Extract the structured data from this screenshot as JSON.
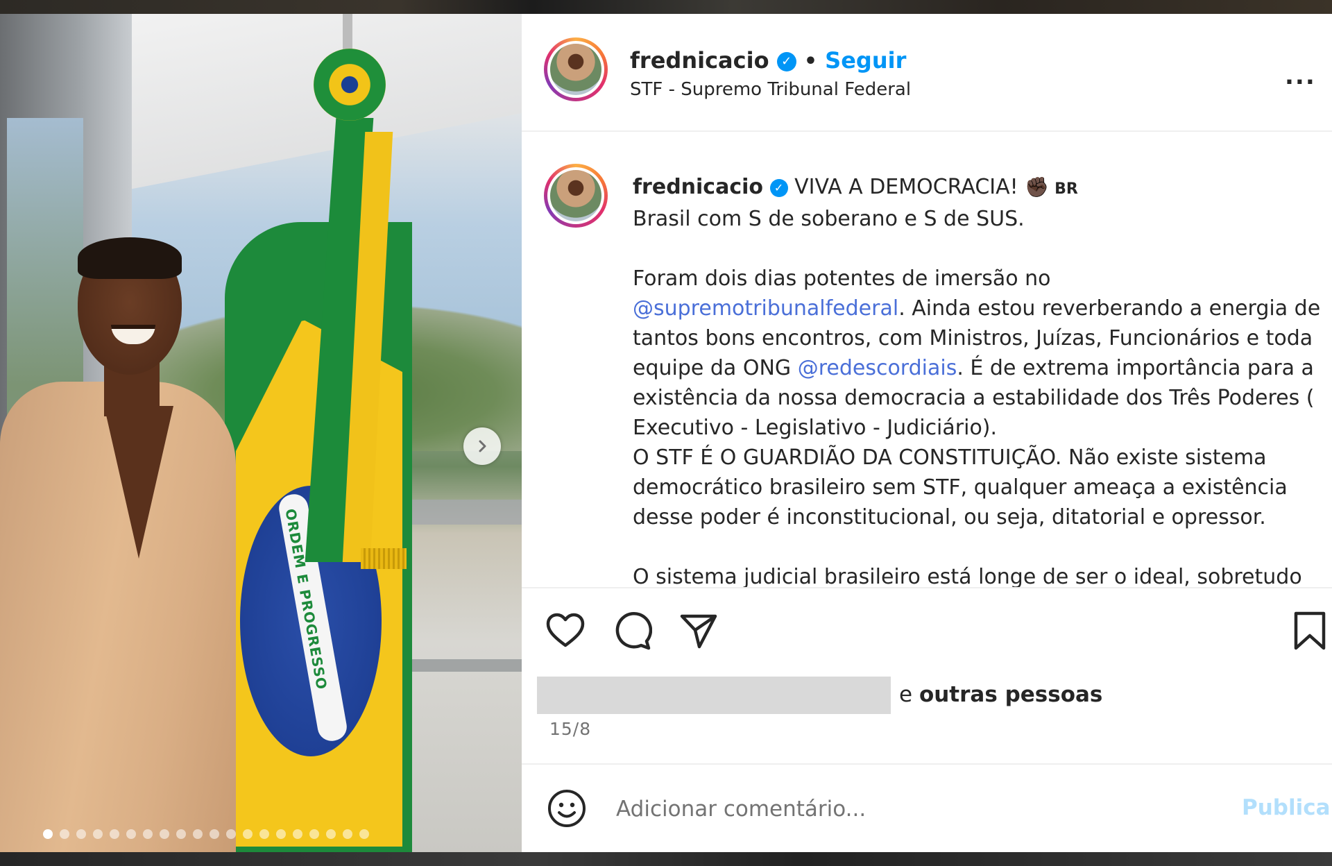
{
  "post": {
    "username": "frednicacio",
    "verified_mark": "✓",
    "separator": "•",
    "follow_label": "Seguir",
    "location": "STF - Supremo Tribunal Federal",
    "more_label": "...",
    "flag_motto": "ORDEM E PROGRESSO"
  },
  "caption": {
    "username": "frednicacio",
    "headline": "VIVA A DEMOCRACIA!",
    "fist_emoji": "✊🏿",
    "flag_code": "BR",
    "line2": "Brasil com S de soberano e S de SUS.",
    "p1_before": "Foram dois dias potentes de imersão no ",
    "mention1": "@supremotribunalfederal",
    "p1_after": ". Ainda estou reverberando a energia de tantos bons encontros, com Ministros, Juízas, Funcionários e toda equipe da ONG ",
    "mention2": "@redescordiais",
    "p1_end": ". É de extrema importância para a existência da nossa democracia a estabilidade dos Três Poderes ( Executivo - Legislativo - Judiciário).",
    "p2": "O STF É O GUARDIÃO DA CONSTITUIÇÃO. Não existe sistema democrático brasileiro sem STF, qualquer ameaça a existência desse poder é inconstitucional, ou seja, ditatorial e opressor.",
    "p3": "O sistema judicial brasileiro está longe de ser o ideal, sobretudo"
  },
  "likes": {
    "and": "e ",
    "others": "outras pessoas"
  },
  "date": "15/8",
  "comment": {
    "placeholder": "Adicionar comentário...",
    "publish_label": "Publicar"
  },
  "carousel": {
    "total_images": 20,
    "current_index": 1
  },
  "icons": [
    "heart-icon",
    "comment-icon",
    "share-icon",
    "bookmark-icon",
    "emoji-icon",
    "chevron-right-icon"
  ],
  "colors": {
    "link": "#0095f6",
    "mention": "#4a6fd8",
    "publish_disabled": "#b2dffc",
    "text": "#262626",
    "muted": "#737373"
  }
}
